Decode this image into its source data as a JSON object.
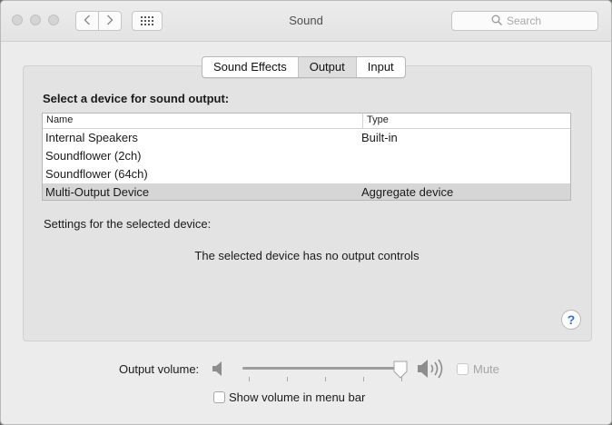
{
  "window": {
    "title": "Sound"
  },
  "search": {
    "placeholder": "Search"
  },
  "tabs": [
    {
      "label": "Sound Effects",
      "selected": false
    },
    {
      "label": "Output",
      "selected": true
    },
    {
      "label": "Input",
      "selected": false
    }
  ],
  "output": {
    "section_title": "Select a device for sound output:",
    "columns": {
      "name": "Name",
      "type": "Type"
    },
    "devices": [
      {
        "name": "Internal Speakers",
        "type": "Built-in",
        "selected": false
      },
      {
        "name": "Soundflower (2ch)",
        "type": "",
        "selected": false
      },
      {
        "name": "Soundflower (64ch)",
        "type": "",
        "selected": false
      },
      {
        "name": "Multi-Output Device",
        "type": "Aggregate device",
        "selected": true
      }
    ],
    "settings_label": "Settings for the selected device:",
    "no_controls_text": "The selected device has no output controls",
    "help_label": "?"
  },
  "volume": {
    "label": "Output volume:",
    "level_fraction": 0.98,
    "mute_label": "Mute",
    "mute_checked": false,
    "show_in_menu_bar_label": "Show volume in menu bar",
    "show_in_menu_bar_checked": false
  },
  "icons": {
    "back": "chevron-left-icon",
    "forward": "chevron-right-icon",
    "grid": "grid-icon",
    "search": "search-icon",
    "volume_low": "speaker-low-icon",
    "volume_high": "speaker-high-icon",
    "help": "help-icon"
  },
  "colors": {
    "help_accent": "#2f70d6",
    "selected_row": "#d6d6d6"
  }
}
